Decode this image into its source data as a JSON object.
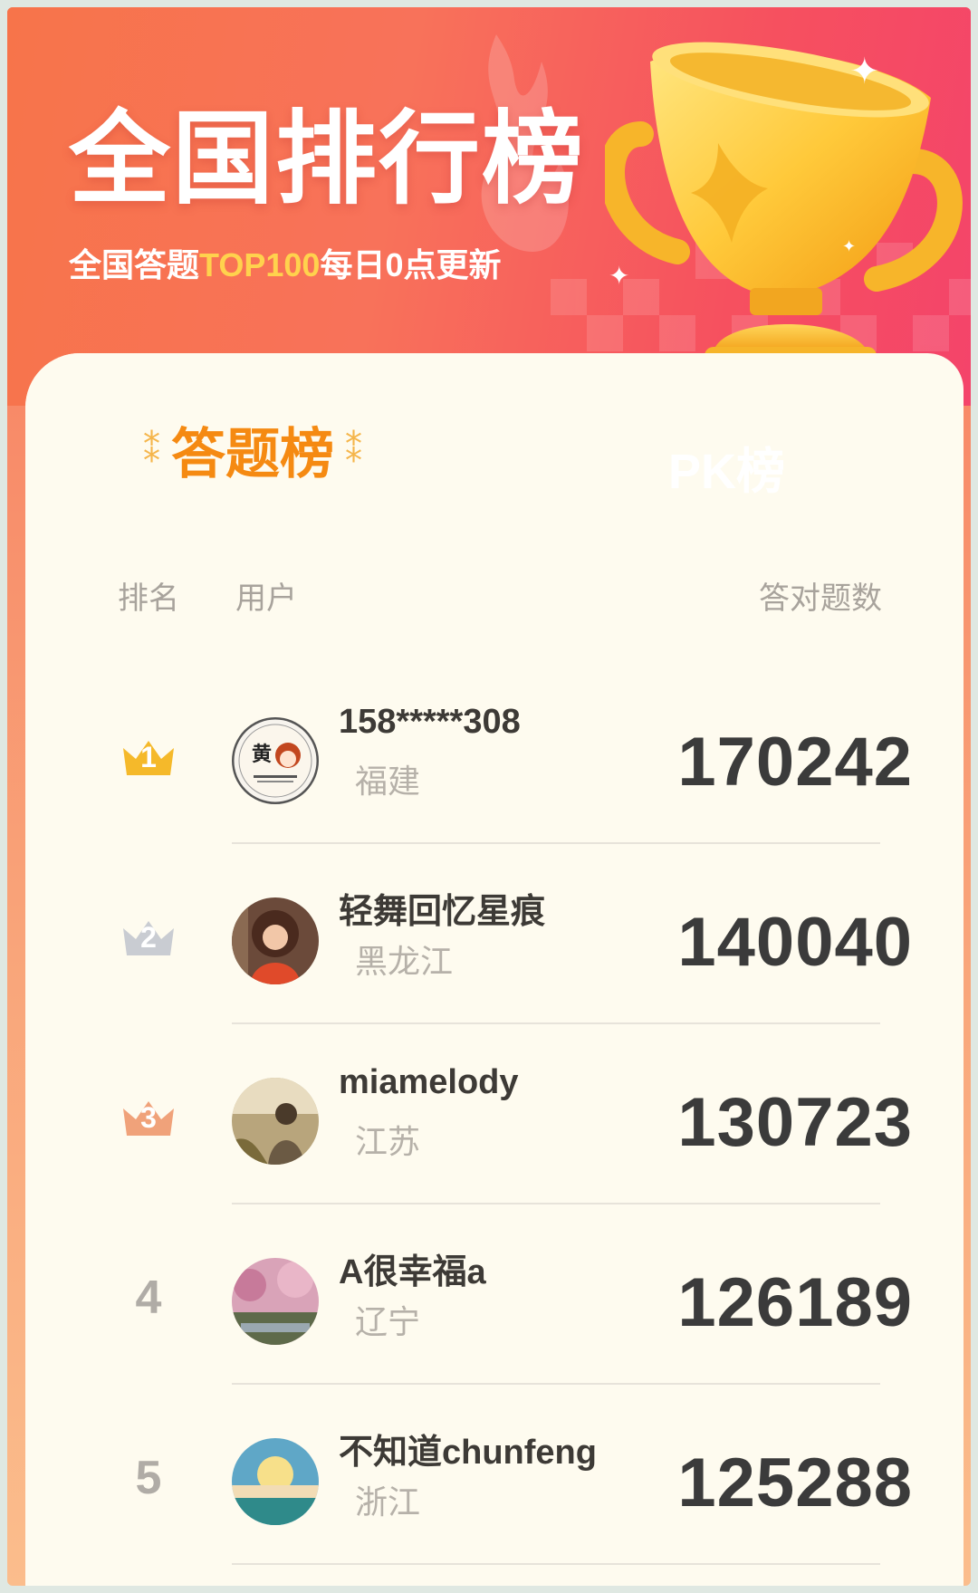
{
  "header": {
    "title": "全国排行榜",
    "subtitle_prefix": "全国答题",
    "subtitle_highlight": "TOP100",
    "subtitle_suffix": "每日0点更新",
    "trophy_icon": "trophy-icon"
  },
  "tabs": [
    {
      "label": "答题榜",
      "active": true
    },
    {
      "label": "PK榜",
      "active": false
    }
  ],
  "table": {
    "columns": {
      "rank": "排名",
      "user": "用户",
      "score": "答对题数"
    },
    "rows": [
      {
        "rank": "1",
        "name": "158*****308",
        "region": "福建",
        "score": "170242"
      },
      {
        "rank": "2",
        "name": "轻舞回忆星痕",
        "region": "黑龙江",
        "score": "140040"
      },
      {
        "rank": "3",
        "name": "miamelody",
        "region": "江苏",
        "score": "130723"
      },
      {
        "rank": "4",
        "name": "A很幸福a",
        "region": "辽宁",
        "score": "126189"
      },
      {
        "rank": "5",
        "name": "不知道chunfeng",
        "region": "浙江",
        "score": "125288"
      }
    ]
  },
  "colors": {
    "accent": "#f58a12",
    "gold": "#f5b92a",
    "silver": "#c9ccd2",
    "bronze": "#f0a27a"
  }
}
